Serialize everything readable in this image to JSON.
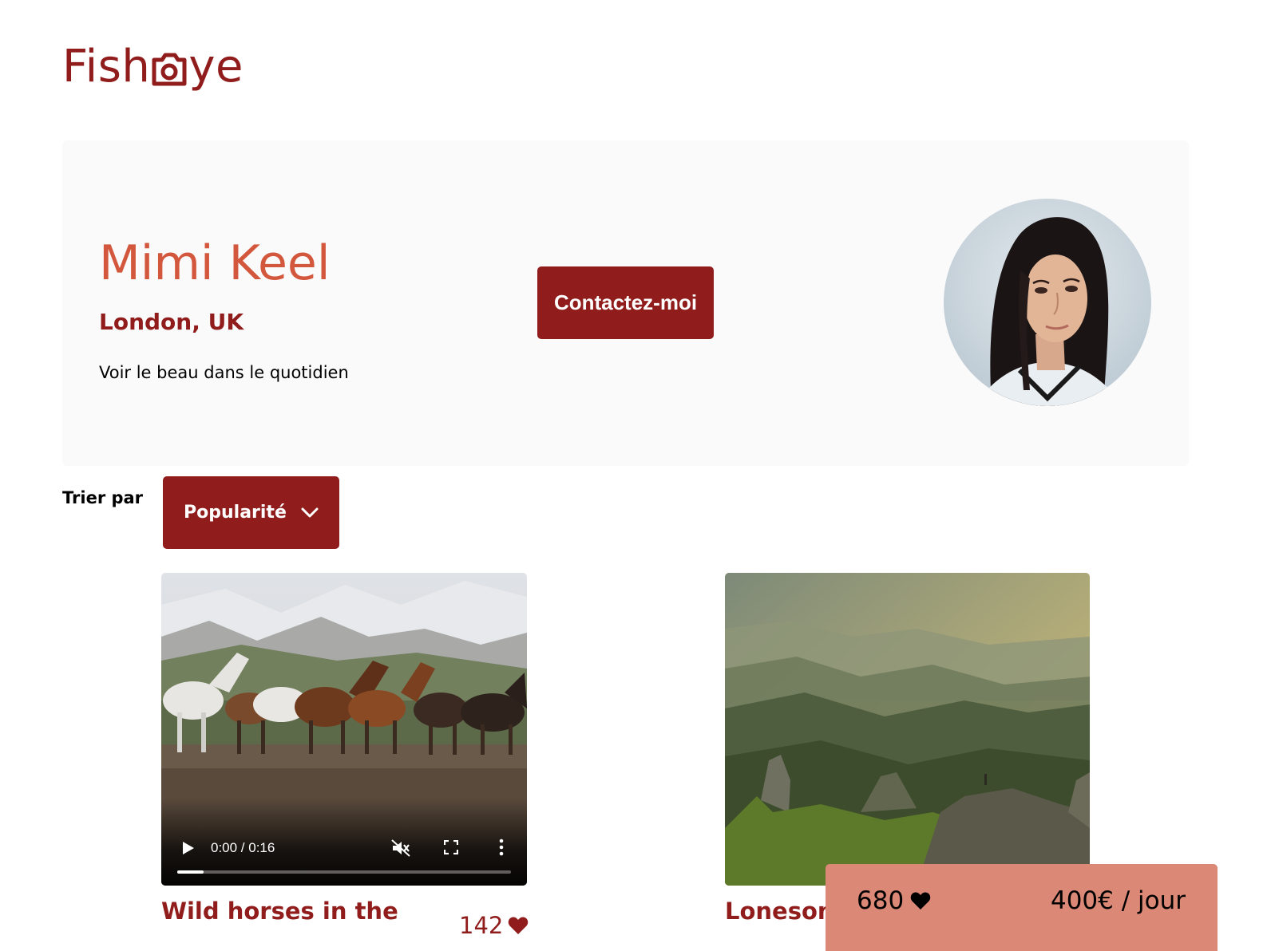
{
  "logo": {
    "text_before": "Fish",
    "text_after": "ye",
    "icon": "camera-icon"
  },
  "photographer": {
    "name": "Mimi Keel",
    "location": "London, UK",
    "tagline": "Voir le beau dans le quotidien"
  },
  "contact_button": {
    "label": "Contactez-moi"
  },
  "sort": {
    "label": "Trier par",
    "selected": "Popularité",
    "icon": "chevron-down-icon"
  },
  "media": [
    {
      "type": "video",
      "title": "Wild horses in the",
      "likes": "142",
      "player": {
        "time": "0:00 / 0:16",
        "progress": 0.08
      }
    },
    {
      "type": "image",
      "title": "Lonesom"
    }
  ],
  "stats": {
    "total_likes": "680",
    "price": "400€ / jour",
    "icon": "heart-icon"
  },
  "colors": {
    "primary": "#901C1C",
    "secondary": "#D3573C",
    "bar": "#DB8876",
    "card_bg": "#FAFAFA"
  }
}
